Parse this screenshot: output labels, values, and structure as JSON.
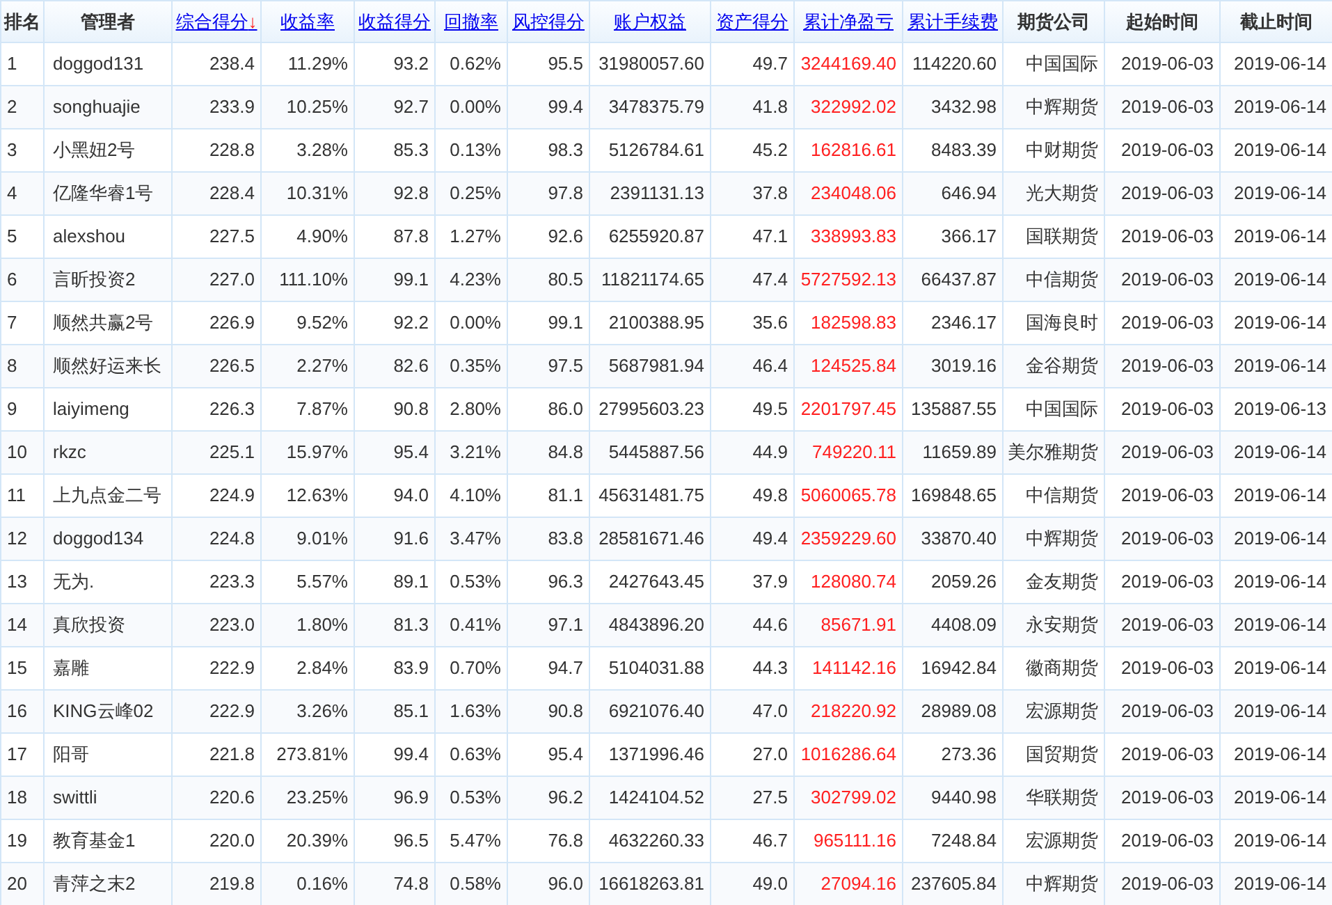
{
  "table": {
    "columns": [
      {
        "label": "排名",
        "sortable": false,
        "kind": "rank"
      },
      {
        "label": "管理者",
        "sortable": false,
        "kind": "name"
      },
      {
        "label": "综合得分",
        "sortable": true,
        "sort_mark": "↓",
        "kind": "number"
      },
      {
        "label": "收益率",
        "sortable": true,
        "kind": "number"
      },
      {
        "label": "收益得分",
        "sortable": true,
        "kind": "number"
      },
      {
        "label": "回撤率",
        "sortable": true,
        "kind": "number"
      },
      {
        "label": "风控得分",
        "sortable": true,
        "kind": "number"
      },
      {
        "label": "账户权益",
        "sortable": true,
        "kind": "number"
      },
      {
        "label": "资产得分",
        "sortable": true,
        "kind": "number"
      },
      {
        "label": "累计净盈亏",
        "sortable": true,
        "kind": "profit"
      },
      {
        "label": "累计手续费",
        "sortable": true,
        "kind": "number"
      },
      {
        "label": "期货公司",
        "sortable": false,
        "kind": "number"
      },
      {
        "label": "起始时间",
        "sortable": false,
        "kind": "number"
      },
      {
        "label": "截止时间",
        "sortable": false,
        "kind": "number"
      }
    ],
    "rows": [
      [
        "1",
        "doggod131",
        "238.4",
        "11.29%",
        "93.2",
        "0.62%",
        "95.5",
        "31980057.60",
        "49.7",
        "3244169.40",
        "114220.60",
        "中国国际",
        "2019-06-03",
        "2019-06-14"
      ],
      [
        "2",
        "songhuajie",
        "233.9",
        "10.25%",
        "92.7",
        "0.00%",
        "99.4",
        "3478375.79",
        "41.8",
        "322992.02",
        "3432.98",
        "中辉期货",
        "2019-06-03",
        "2019-06-14"
      ],
      [
        "3",
        "小黑妞2号",
        "228.8",
        "3.28%",
        "85.3",
        "0.13%",
        "98.3",
        "5126784.61",
        "45.2",
        "162816.61",
        "8483.39",
        "中财期货",
        "2019-06-03",
        "2019-06-14"
      ],
      [
        "4",
        "亿隆华睿1号",
        "228.4",
        "10.31%",
        "92.8",
        "0.25%",
        "97.8",
        "2391131.13",
        "37.8",
        "234048.06",
        "646.94",
        "光大期货",
        "2019-06-03",
        "2019-06-14"
      ],
      [
        "5",
        "alexshou",
        "227.5",
        "4.90%",
        "87.8",
        "1.27%",
        "92.6",
        "6255920.87",
        "47.1",
        "338993.83",
        "366.17",
        "国联期货",
        "2019-06-03",
        "2019-06-14"
      ],
      [
        "6",
        "言昕投资2",
        "227.0",
        "111.10%",
        "99.1",
        "4.23%",
        "80.5",
        "11821174.65",
        "47.4",
        "5727592.13",
        "66437.87",
        "中信期货",
        "2019-06-03",
        "2019-06-14"
      ],
      [
        "7",
        "顺然共赢2号",
        "226.9",
        "9.52%",
        "92.2",
        "0.00%",
        "99.1",
        "2100388.95",
        "35.6",
        "182598.83",
        "2346.17",
        "国海良时",
        "2019-06-03",
        "2019-06-14"
      ],
      [
        "8",
        "顺然好运来长",
        "226.5",
        "2.27%",
        "82.6",
        "0.35%",
        "97.5",
        "5687981.94",
        "46.4",
        "124525.84",
        "3019.16",
        "金谷期货",
        "2019-06-03",
        "2019-06-14"
      ],
      [
        "9",
        "laiyimeng",
        "226.3",
        "7.87%",
        "90.8",
        "2.80%",
        "86.0",
        "27995603.23",
        "49.5",
        "2201797.45",
        "135887.55",
        "中国国际",
        "2019-06-03",
        "2019-06-13"
      ],
      [
        "10",
        "rkzc",
        "225.1",
        "15.97%",
        "95.4",
        "3.21%",
        "84.8",
        "5445887.56",
        "44.9",
        "749220.11",
        "11659.89",
        "美尔雅期货",
        "2019-06-03",
        "2019-06-14"
      ],
      [
        "11",
        "上九点金二号",
        "224.9",
        "12.63%",
        "94.0",
        "4.10%",
        "81.1",
        "45631481.75",
        "49.8",
        "5060065.78",
        "169848.65",
        "中信期货",
        "2019-06-03",
        "2019-06-14"
      ],
      [
        "12",
        "doggod134",
        "224.8",
        "9.01%",
        "91.6",
        "3.47%",
        "83.8",
        "28581671.46",
        "49.4",
        "2359229.60",
        "33870.40",
        "中辉期货",
        "2019-06-03",
        "2019-06-14"
      ],
      [
        "13",
        "无为.",
        "223.3",
        "5.57%",
        "89.1",
        "0.53%",
        "96.3",
        "2427643.45",
        "37.9",
        "128080.74",
        "2059.26",
        "金友期货",
        "2019-06-03",
        "2019-06-14"
      ],
      [
        "14",
        "真欣投资",
        "223.0",
        "1.80%",
        "81.3",
        "0.41%",
        "97.1",
        "4843896.20",
        "44.6",
        "85671.91",
        "4408.09",
        "永安期货",
        "2019-06-03",
        "2019-06-14"
      ],
      [
        "15",
        "嘉雕",
        "222.9",
        "2.84%",
        "83.9",
        "0.70%",
        "94.7",
        "5104031.88",
        "44.3",
        "141142.16",
        "16942.84",
        "徽商期货",
        "2019-06-03",
        "2019-06-14"
      ],
      [
        "16",
        "KING云峰02",
        "222.9",
        "3.26%",
        "85.1",
        "1.63%",
        "90.8",
        "6921076.40",
        "47.0",
        "218220.92",
        "28989.08",
        "宏源期货",
        "2019-06-03",
        "2019-06-14"
      ],
      [
        "17",
        "阳哥",
        "221.8",
        "273.81%",
        "99.4",
        "0.63%",
        "95.4",
        "1371996.46",
        "27.0",
        "1016286.64",
        "273.36",
        "国贸期货",
        "2019-06-03",
        "2019-06-14"
      ],
      [
        "18",
        "swittli",
        "220.6",
        "23.25%",
        "96.9",
        "0.53%",
        "96.2",
        "1424104.52",
        "27.5",
        "302799.02",
        "9440.98",
        "华联期货",
        "2019-06-03",
        "2019-06-14"
      ],
      [
        "19",
        "教育基金1",
        "220.0",
        "20.39%",
        "96.5",
        "5.47%",
        "76.8",
        "4632260.33",
        "46.7",
        "965111.16",
        "7248.84",
        "宏源期货",
        "2019-06-03",
        "2019-06-14"
      ],
      [
        "20",
        "青萍之末2",
        "219.8",
        "0.16%",
        "74.8",
        "0.58%",
        "96.0",
        "16618263.81",
        "49.0",
        "27094.16",
        "237605.84",
        "中辉期货",
        "2019-06-03",
        "2019-06-14"
      ]
    ]
  }
}
